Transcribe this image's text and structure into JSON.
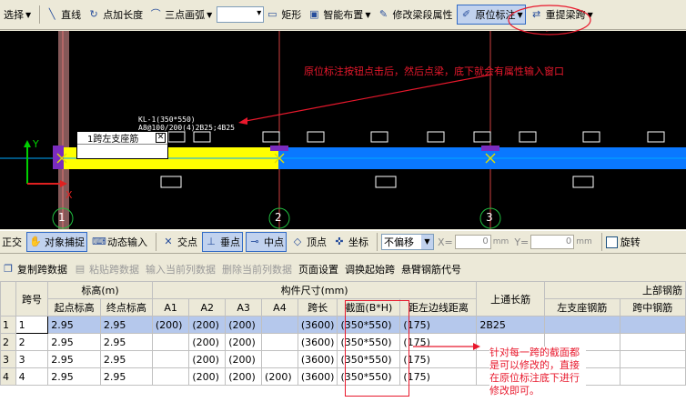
{
  "toolbar1": {
    "select_label": "选择",
    "line_label": "直线",
    "point_length_label": "点加长度",
    "three_point_arc_label": "三点画弧",
    "rect_label": "矩形",
    "smart_layout_label": "智能布置",
    "modify_span_label": "修改梁段属性",
    "in_situ_label": "原位标注",
    "repick_span_label": "重提梁跨"
  },
  "cad": {
    "beam_label_line1": "KL-1(350*550)",
    "beam_label_line2": "A8@100/200(4)2B25;4B25",
    "input_box_label": "1跨左支座筋",
    "axis_y": "Y",
    "axis_x": "X",
    "grid_labels": [
      "1",
      "2",
      "3"
    ],
    "annotation": "原位标注按钮点击后，然后点梁，底下就会有属性输入窗口"
  },
  "toolbar3": {
    "ortho_label": "正交",
    "snap_label": "对象捕捉",
    "dynamic_input_label": "动态输入",
    "intersection_label": "交点",
    "perp_label": "垂点",
    "mid_label": "中点",
    "vertex_label": "顶点",
    "coord_label": "坐标",
    "offset_select": "不偏移",
    "x_label": "X=",
    "x_value": "0",
    "y_label": "Y=",
    "y_value": "0",
    "unit": "mm",
    "rotate_label": "旋转"
  },
  "toolbar4": {
    "items": [
      "复制跨数据",
      "粘贴跨数据",
      "输入当前列数据",
      "删除当前列数据",
      "页面设置",
      "调换起始跨",
      "悬臂钢筋代号"
    ],
    "enabled": [
      true,
      false,
      false,
      false,
      true,
      true,
      true
    ]
  },
  "grid": {
    "h_span": "跨号",
    "h_elev": "标高(m)",
    "h_dims": "构件尺寸(mm)",
    "h_top_through": "上通长筋",
    "h_top_bars": "上部钢筋",
    "h_start_elev": "起点标高",
    "h_end_elev": "终点标高",
    "h_a1": "A1",
    "h_a2": "A2",
    "h_a3": "A3",
    "h_a4": "A4",
    "h_span_len": "跨长",
    "h_section": "截面(B*H)",
    "h_edge_dist": "距左边线距离",
    "h_left_support": "左支座钢筋",
    "h_mid_span": "跨中钢筋",
    "rows": [
      {
        "num": "1",
        "span": "1",
        "start": "2.95",
        "end": "2.95",
        "a1": "(200)",
        "a2": "(200)",
        "a3": "(200)",
        "a4": "",
        "len": "(3600)",
        "section": "(350*550)",
        "dist": "(175)",
        "top": "2B25",
        "left": "",
        "mid": ""
      },
      {
        "num": "2",
        "span": "2",
        "start": "2.95",
        "end": "2.95",
        "a1": "",
        "a2": "(200)",
        "a3": "(200)",
        "a4": "",
        "len": "(3600)",
        "section": "(350*550)",
        "dist": "(175)",
        "top": "",
        "left": "",
        "mid": ""
      },
      {
        "num": "3",
        "span": "3",
        "start": "2.95",
        "end": "2.95",
        "a1": "",
        "a2": "(200)",
        "a3": "(200)",
        "a4": "",
        "len": "(3600)",
        "section": "(350*550)",
        "dist": "(175)",
        "top": "",
        "left": "",
        "mid": ""
      },
      {
        "num": "4",
        "span": "4",
        "start": "2.95",
        "end": "2.95",
        "a1": "",
        "a2": "(200)",
        "a3": "(200)",
        "a4": "(200)",
        "len": "(3600)",
        "section": "(350*550)",
        "dist": "(175)",
        "top": "",
        "left": "",
        "mid": ""
      }
    ],
    "annotation": "针对每一跨的截面都是可以修改的，直接在原位标注底下进行修改即可。"
  },
  "colors": {
    "beam_yellow": "#ffff00",
    "beam_blue": "#0a78ff",
    "annotation_red": "#e8182c",
    "selection": "#b5c8ec"
  }
}
